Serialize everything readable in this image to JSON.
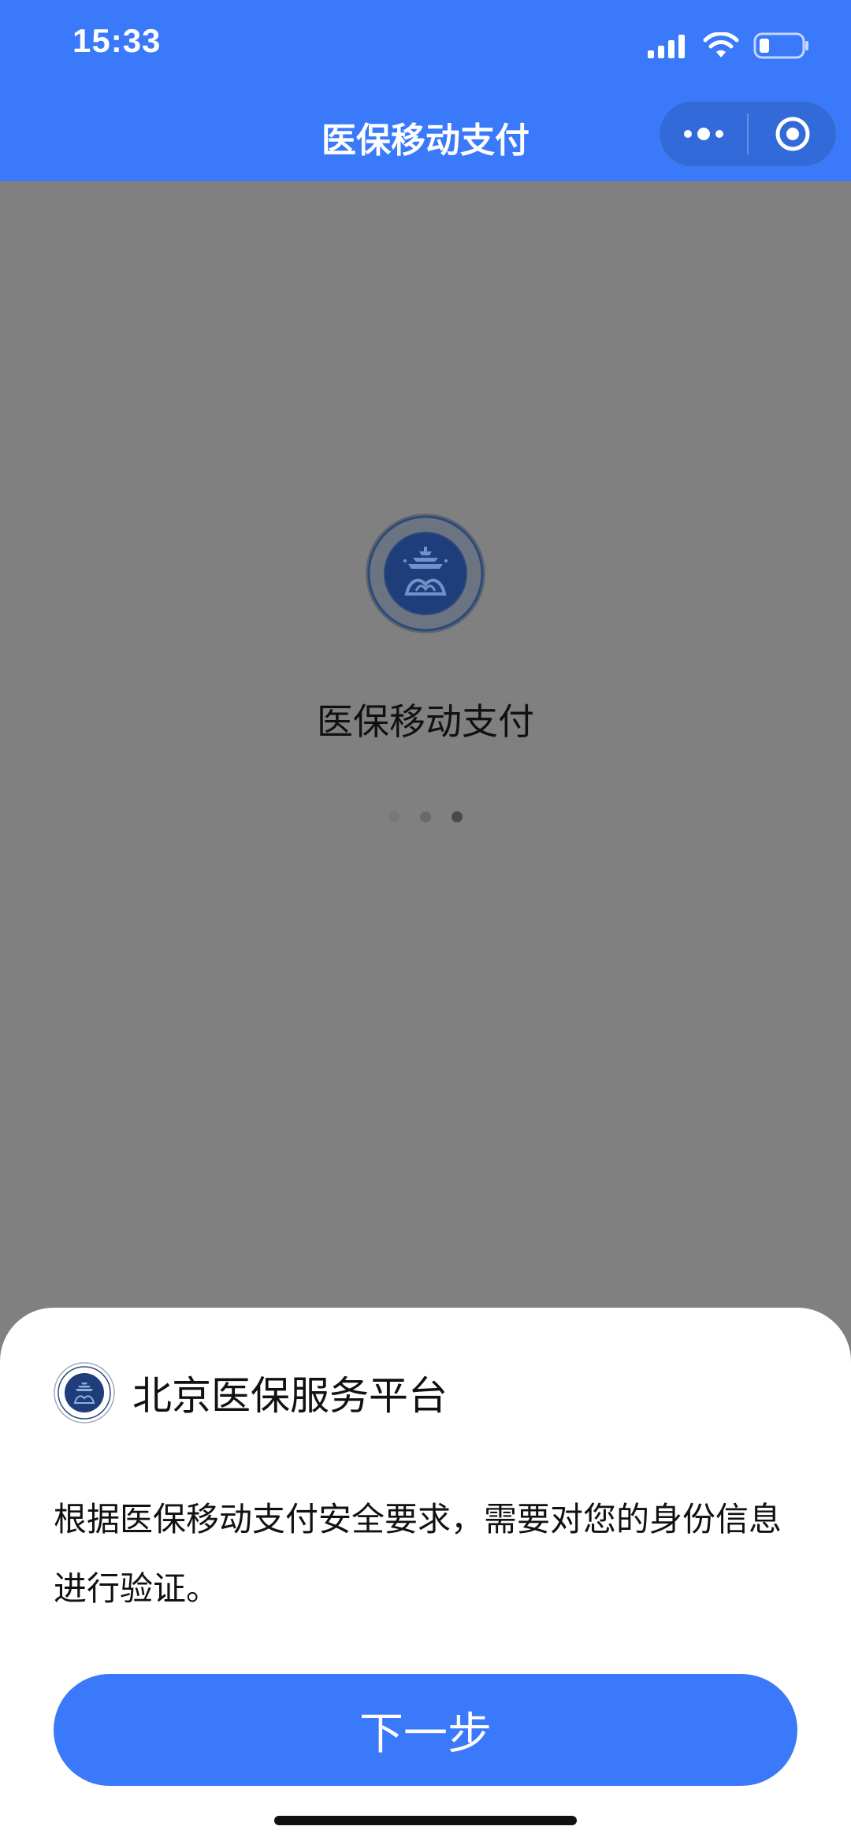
{
  "status_bar": {
    "time": "15:33",
    "icons": [
      "signal-icon",
      "wifi-icon",
      "battery-icon"
    ]
  },
  "nav": {
    "title": "医保移动支付",
    "capsule": [
      "more-icon",
      "close-miniprogram-icon"
    ]
  },
  "loading": {
    "title": "医保移动支付",
    "logo": "beijing-medical-insurance-logo",
    "dots": 3
  },
  "sheet": {
    "app_name": "北京医保服务平台",
    "message": "根据医保移动支付安全要求，需要对您的身份信息进行验证。",
    "next_button_label": "下一步"
  },
  "colors": {
    "brand_blue": "#3a79f9",
    "overlay_gray": "#808080",
    "logo_navy": "#1f3d7a"
  }
}
